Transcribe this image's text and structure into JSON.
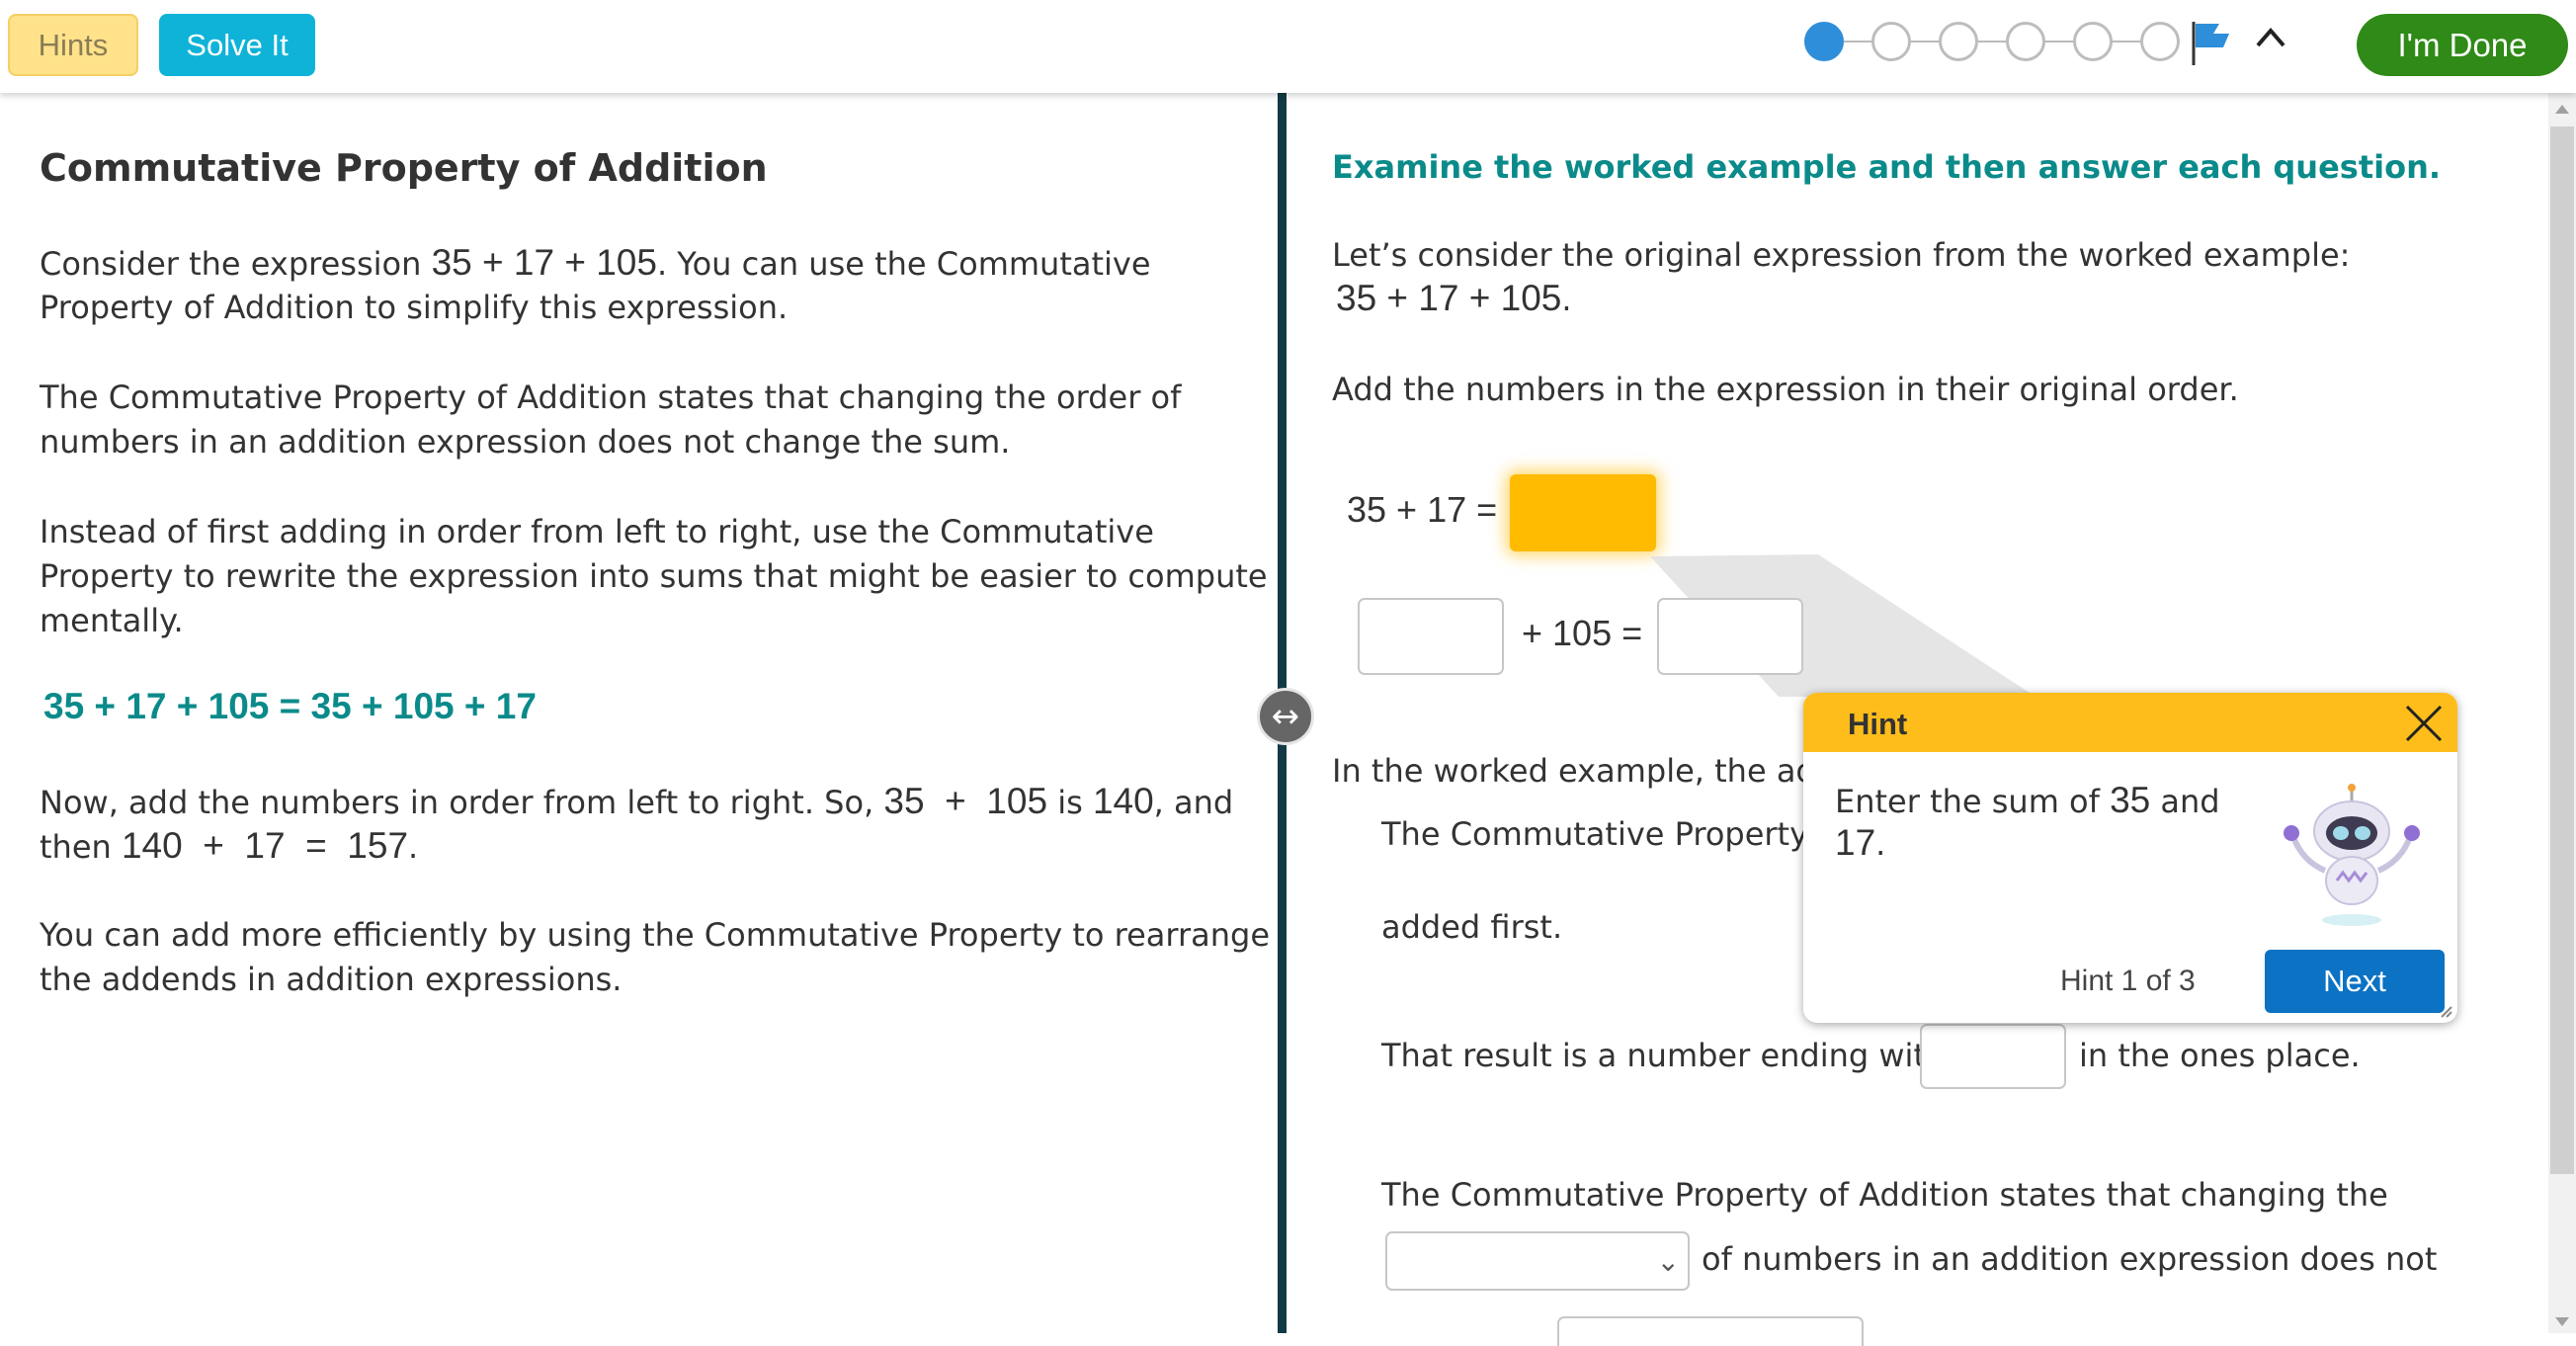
{
  "toolbar": {
    "hints_label": "Hints",
    "solve_label": "Solve It",
    "done_label": "I'm Done",
    "progress_steps": 6,
    "progress_current": 1
  },
  "left": {
    "title": "Commutative Property of Addition",
    "p1_a": "Consider the expression",
    "p1_math": "35 + 17 + 105",
    "p1_b": ". You can use the Commutative",
    "p1_c": "Property of Addition to simplify this expression.",
    "p2_a": "The Commutative Property of Addition states that changing the order of",
    "p2_b": "numbers in an addition expression does not change the sum.",
    "p3_a": "Instead of first adding in order from left to right, use the Commutative",
    "p3_b": "Property to rewrite the expression into sums that might be easier to compute",
    "p3_c": "mentally.",
    "green_eq": "35 + 17 + 105 = 35 + 105 + 17",
    "p4_a": "Now, add the numbers in order from left to right. So,",
    "p4_m1": "35  +  105",
    "p4_is": "is",
    "p4_m2": "140",
    "p4_and": ", and",
    "p4_then": "then",
    "p4_m3": "140  +  17  =  157",
    "p4_dot": ".",
    "p5_a": "You can add more efficiently by using the Commutative Property to rearrange",
    "p5_b": "the addends in addition expressions."
  },
  "right": {
    "heading": "Examine the worked example and then answer each question.",
    "intro_a": "Let’s consider the original expression from the worked example:",
    "intro_math": "35 + 17 + 105",
    "intro_dot": ".",
    "instruction": "Add the numbers in the expression in their original order.",
    "eq1_left": "35 + 17 =",
    "eq2_mid": "+ 105 =",
    "q2_a": "In the worked example, the adde",
    "q2_b": "The Commutative Property w",
    "q2_c": "added first.",
    "q3_a": "That result is a number ending with",
    "q3_b": "in the ones place.",
    "q4_a": "The Commutative Property of Addition states that changing the",
    "q4_b": "of numbers in an addition expression does not"
  },
  "hint": {
    "title": "Hint",
    "body_a": "Enter the sum of",
    "body_n1": "35",
    "body_and": "and",
    "body_n2": "17",
    "body_dot": ".",
    "counter": "Hint 1 of 3",
    "next_label": "Next"
  }
}
